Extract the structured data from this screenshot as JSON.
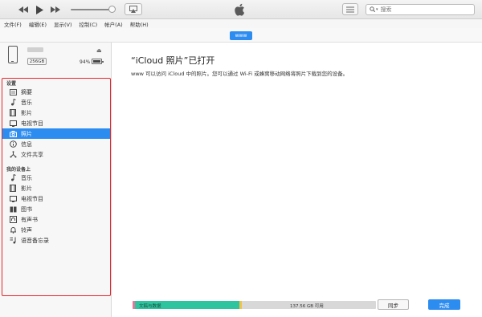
{
  "toolbar": {
    "search_placeholder": "搜索",
    "icons": [
      "rewind-icon",
      "play-icon",
      "fast-forward-icon",
      "airplay-icon",
      "apple-logo",
      "list-view-icon",
      "search-icon"
    ],
    "volume_level": 0.85
  },
  "menu": {
    "items": [
      {
        "label": "文件(F)"
      },
      {
        "label": "编辑(E)"
      },
      {
        "label": "显示(V)"
      },
      {
        "label": "控制(C)"
      },
      {
        "label": "帐户(A)"
      },
      {
        "label": "帮助(H)"
      }
    ]
  },
  "device": {
    "tab_label": "www",
    "capacity": "256GB",
    "battery": "94%"
  },
  "sidebar": {
    "settings_header": "设置",
    "settings_items": [
      {
        "label": "摘要",
        "icon": "summary-icon",
        "selected": false
      },
      {
        "label": "音乐",
        "icon": "music-icon",
        "selected": false
      },
      {
        "label": "影片",
        "icon": "film-icon",
        "selected": false
      },
      {
        "label": "电视节目",
        "icon": "tv-icon",
        "selected": false
      },
      {
        "label": "照片",
        "icon": "camera-icon",
        "selected": true
      },
      {
        "label": "信息",
        "icon": "info-icon",
        "selected": false
      },
      {
        "label": "文件共享",
        "icon": "file-sharing-icon",
        "selected": false
      }
    ],
    "ondevice_header": "我的设备上",
    "ondevice_items": [
      {
        "label": "音乐",
        "icon": "music-icon"
      },
      {
        "label": "影片",
        "icon": "film-icon"
      },
      {
        "label": "电视节目",
        "icon": "tv-icon"
      },
      {
        "label": "图书",
        "icon": "books-icon"
      },
      {
        "label": "有声书",
        "icon": "audiobook-icon"
      },
      {
        "label": "铃声",
        "icon": "bell-icon"
      },
      {
        "label": "语音备忘录",
        "icon": "voice-memo-icon"
      }
    ]
  },
  "main": {
    "title": "“iCloud 照片”已打开",
    "description": "www 可以访问 iCloud 中的照片。您可以通过 Wi-Fi 或蜂窝移动网络将照片下载到您的设备。"
  },
  "storage": {
    "used_label": "文稿与数据",
    "free_label": "137.56 GB 可用",
    "segments": [
      {
        "name": "pink",
        "color": "#e8739b",
        "fraction": 0.01
      },
      {
        "name": "documents",
        "color": "#2ec4a0",
        "fraction": 0.43
      },
      {
        "name": "yellow",
        "color": "#f2c14a",
        "fraction": 0.01
      }
    ],
    "free_color": "#d8d8d8"
  },
  "buttons": {
    "sync": "同步",
    "done": "完成"
  },
  "colors": {
    "accent": "#2d8cf0",
    "highlight_border": "#e8242a"
  }
}
